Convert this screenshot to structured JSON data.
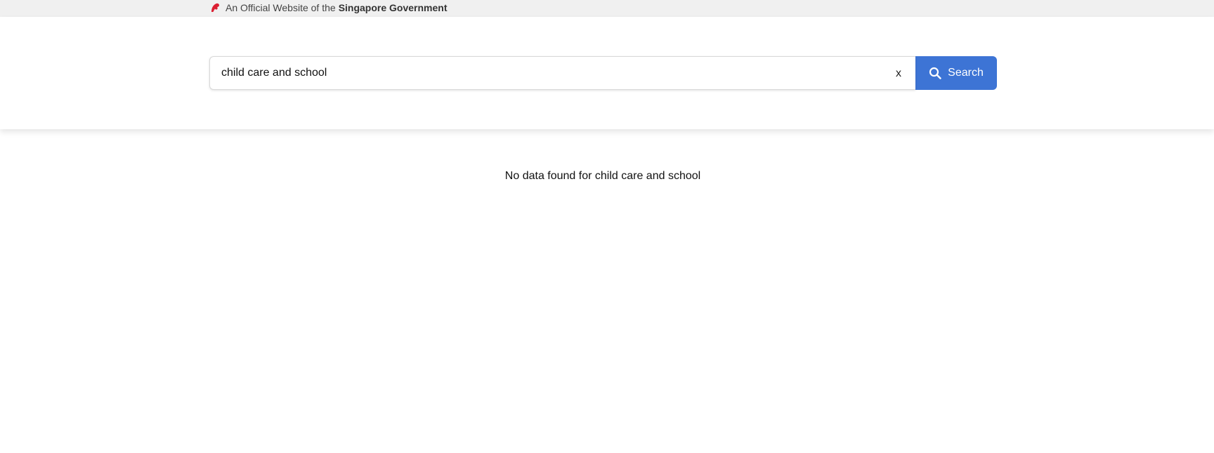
{
  "masthead": {
    "prefix": "An Official Website of the",
    "strong": "Singapore Government",
    "icon": "singapore-lion-icon",
    "accent_color": "#db1f32"
  },
  "search": {
    "value": "child care and school",
    "clear_label": "x",
    "button_label": "Search",
    "button_icon": "search-icon",
    "button_color": "#3d74d5"
  },
  "results": {
    "message": "No data found for child care and school"
  }
}
